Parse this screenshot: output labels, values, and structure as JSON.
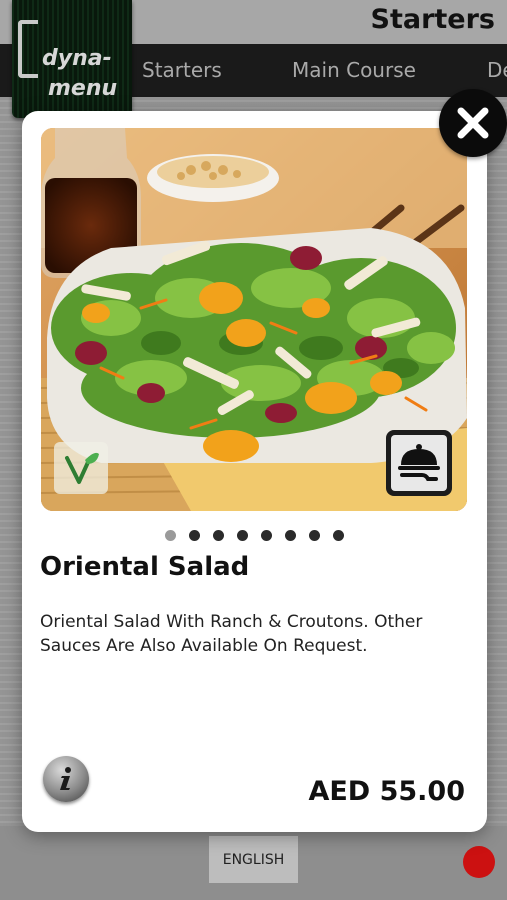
{
  "app": {
    "header_title": "Starters",
    "logo_top": "dyna-",
    "logo_bottom": "menu",
    "nav": [
      {
        "label": "Starters"
      },
      {
        "label": "Main Course"
      },
      {
        "label": "De"
      }
    ],
    "language_button": "ENGLISH"
  },
  "modal": {
    "close_label": "X",
    "item_name": "Oriental Salad",
    "description": "Oriental Salad With Ranch & Croutons. Other Sauces Are Also Available On Request.",
    "price": "AED 55.00",
    "pager": {
      "total": 8,
      "active_index": 0
    },
    "icons": {
      "vegetarian": "vegetarian-leaf-icon",
      "serving": "cloche-serving-icon",
      "info": "info-icon"
    }
  },
  "colors": {
    "nav_background": "#1a1a1a",
    "modal_background": "#ffffff",
    "close_button": "#0b0b0b",
    "status_dot": "#cc1111"
  }
}
